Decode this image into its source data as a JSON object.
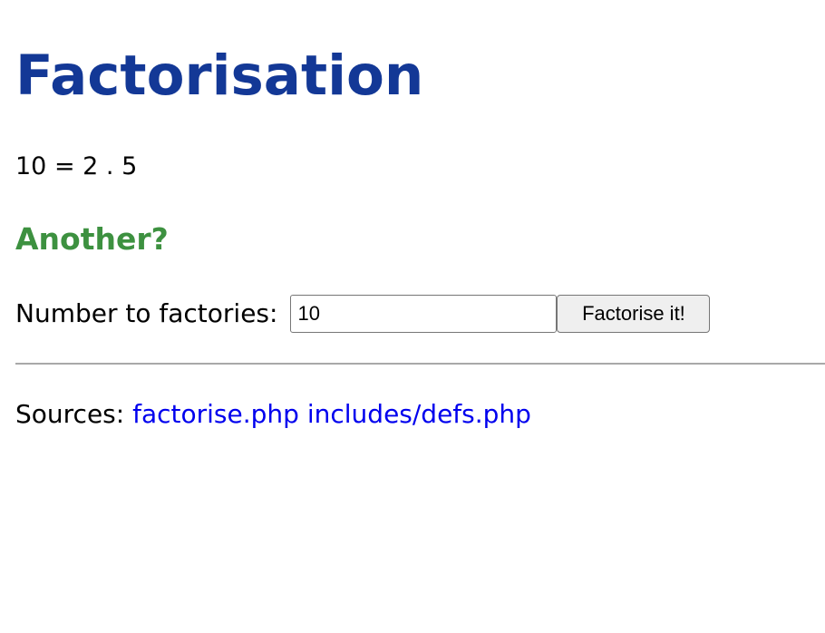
{
  "page": {
    "title": "Factorisation",
    "result": "10 = 2 . 5",
    "another_heading": "Another?"
  },
  "form": {
    "label": "Number to factories:",
    "input_value": "10",
    "submit_label": "Factorise it!"
  },
  "sources": {
    "label": "Sources:",
    "links": [
      "factorise.php",
      "includes/defs.php"
    ]
  },
  "colors": {
    "title": "#133896",
    "another_heading": "#3d9140",
    "link": "#0000ee",
    "divider": "#a9a9a9"
  }
}
